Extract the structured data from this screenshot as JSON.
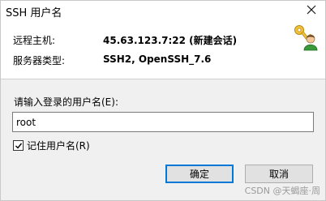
{
  "window": {
    "title": "SSH 用户名"
  },
  "info": {
    "host_label": "远程主机:",
    "host_value": "45.63.123.7:22 (新建会话)",
    "server_type_label": "服务器类型:",
    "server_type_value": "SSH2, OpenSSH_7.6"
  },
  "form": {
    "prompt_label": "请输入登录的用户名(E):",
    "username_value": "root",
    "remember_label": "记住用户名(R)",
    "remember_checked": true
  },
  "buttons": {
    "ok_label": "确定",
    "cancel_label": "取消"
  },
  "watermark": "CSDN @天蝎座·周",
  "icons": {
    "title_close": "close-icon",
    "keys": "keys-user-icon",
    "checkbox": "check-icon"
  }
}
